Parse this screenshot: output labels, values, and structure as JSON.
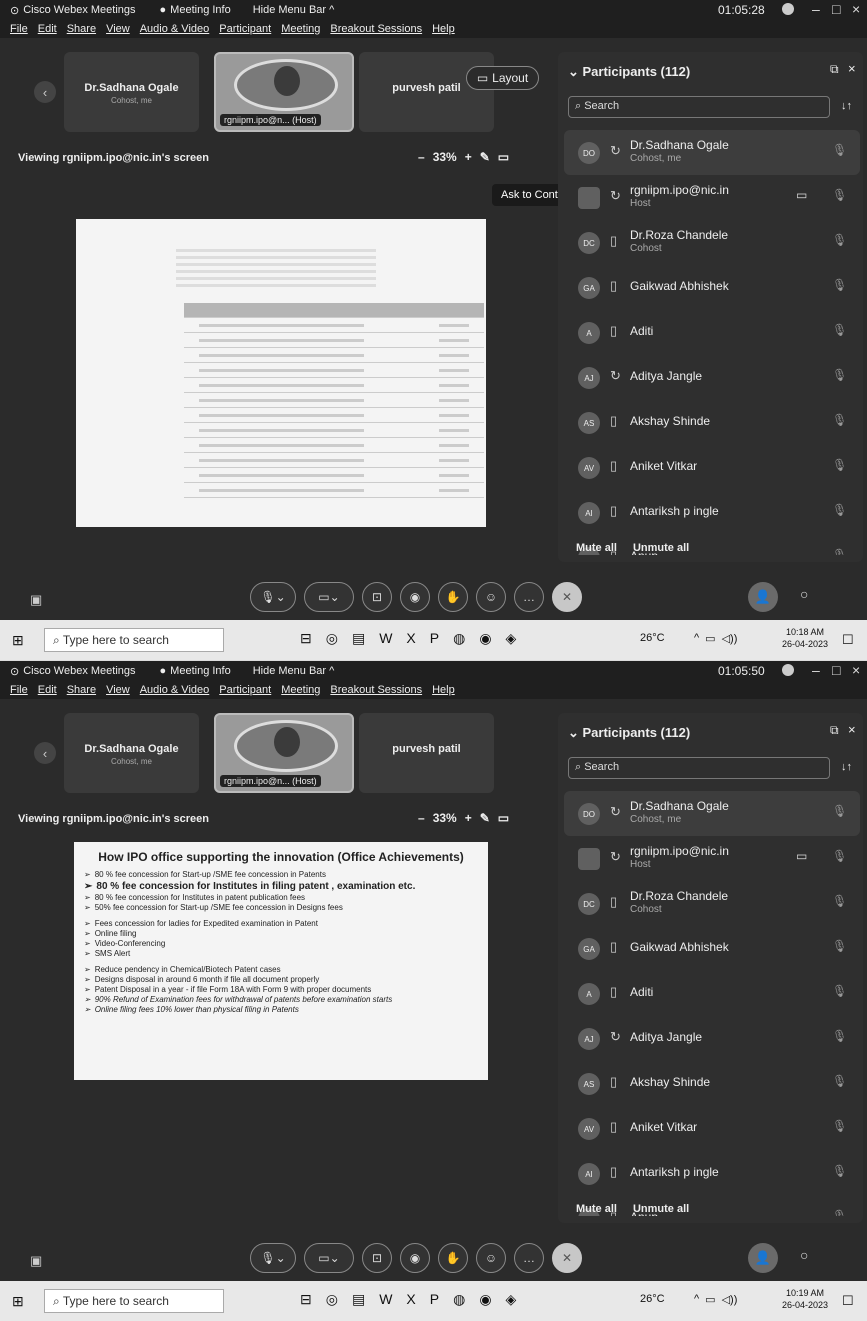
{
  "title_bar": {
    "app_name": "Cisco Webex Meetings",
    "meeting_info": "Meeting Info",
    "hide_menu_bar": "Hide Menu Bar ^",
    "time_1": "01:05:28",
    "time_2": "01:05:50",
    "minimize": "–",
    "restore": "□",
    "close": "×"
  },
  "menu": [
    "File",
    "Edit",
    "Share",
    "View",
    "Audio & Video",
    "Participant",
    "Meeting",
    "Breakout Sessions",
    "Help"
  ],
  "thumbnails": {
    "tile_1": {
      "name": "Dr.Sadhana Ogale",
      "role": "Cohost, me"
    },
    "host_label": "rgniipm.ipo@n... (Host)",
    "tile_3": {
      "name": "purvesh patil"
    }
  },
  "layout_button": "Layout",
  "viewing_label": "Viewing rgniipm.ipo@nic.in's screen",
  "zoom": {
    "minus": "–",
    "value": "33%",
    "plus": "+"
  },
  "ask_to_control": "Ask to Control",
  "document_2": {
    "heading": "How IPO office  supporting the innovation (Office Achievements)",
    "group_1": [
      {
        "text": "80 % fee concession for Start-up /SME fee concession in Patents",
        "style": ""
      },
      {
        "text": "80 % fee concession for Institutes in filing patent , examination etc.",
        "style": "big"
      },
      {
        "text": "80 % fee concession for Institutes in patent publication fees",
        "style": ""
      },
      {
        "text": "50% fee concession for Start-up /SME fee concession in Designs fees",
        "style": ""
      }
    ],
    "group_2": [
      {
        "text": "Fees concession for ladies for Expedited examination in Patent",
        "style": ""
      },
      {
        "text": "Online filing",
        "style": ""
      },
      {
        "text": "Video-Conferencing",
        "style": ""
      },
      {
        "text": "SMS Alert",
        "style": ""
      }
    ],
    "group_3": [
      {
        "text": "Reduce pendency in Chemical/Biotech Patent cases",
        "style": ""
      },
      {
        "text": "Designs disposal in around 6 month if file all document properly",
        "style": ""
      },
      {
        "text": "Patent Disposal in a year - if file Form 18A with Form 9 with proper documents",
        "style": ""
      },
      {
        "text": "90% Refund of Examination fees for withdrawal of  patents before examination starts",
        "style": "it"
      },
      {
        "text": "Online filing  fees 10% lower than physical filing in Patents",
        "style": "it"
      }
    ]
  },
  "participants": {
    "header": "Participants (112)",
    "search_placeholder": "Search",
    "items": [
      {
        "initials": "DO",
        "name": "Dr.Sadhana Ogale",
        "role": "Cohost, me"
      },
      {
        "initials": "",
        "name": "rgniipm.ipo@nic.in",
        "role": "Host"
      },
      {
        "initials": "DC",
        "name": "Dr.Roza Chandele",
        "role": "Cohost"
      },
      {
        "initials": "GA",
        "name": "Gaikwad Abhishek",
        "role": ""
      },
      {
        "initials": "A",
        "name": "Aditi",
        "role": ""
      },
      {
        "initials": "AJ",
        "name": "Aditya Jangle",
        "role": ""
      },
      {
        "initials": "AS",
        "name": "Akshay Shinde",
        "role": ""
      },
      {
        "initials": "AV",
        "name": "Aniket Vitkar",
        "role": ""
      },
      {
        "initials": "AI",
        "name": "Antariksh p ingle",
        "role": ""
      },
      {
        "initials": "A",
        "name": "Anup",
        "role": ""
      }
    ],
    "mute_all": "Mute all",
    "unmute_all": "Unmute all"
  },
  "taskbar": {
    "search_placeholder": "Type here to search",
    "weather": "26°C",
    "clock_1": {
      "time": "10:18 AM",
      "date": "26-04-2023"
    },
    "clock_2": {
      "time": "10:19 AM",
      "date": "26-04-2023"
    }
  }
}
